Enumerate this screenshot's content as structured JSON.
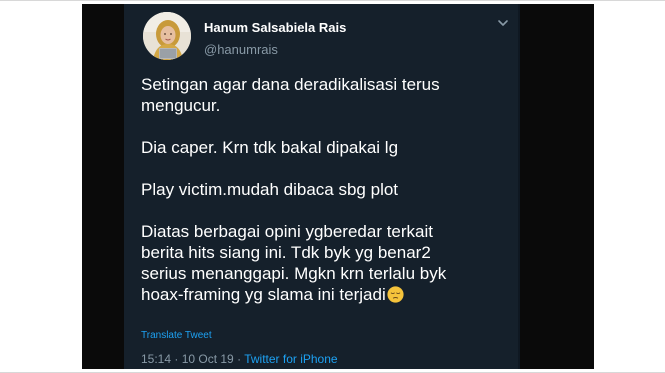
{
  "tweet": {
    "display_name": "Hanum Salsabiela Rais",
    "handle": "@hanumrais",
    "paragraphs": [
      {
        "lines": [
          "Setingan agar dana deradikalisasi terus",
          "mengucur."
        ]
      },
      {
        "lines": [
          "Dia caper. Krn tdk bakal dipakai lg"
        ]
      },
      {
        "lines": [
          "Play victim.mudah dibaca sbg plot"
        ]
      },
      {
        "lines": [
          "Diatas berbagai opini ygberedar terkait",
          "berita hits siang ini. Tdk byk yg benar2",
          "serius menanggapi. Mgkn krn terlalu byk",
          "hoax-framing yg slama ini terjadi"
        ]
      }
    ],
    "emoji": "pensive-face",
    "translate_label": "Translate Tweet",
    "time": "15:14",
    "date": "10 Oct 19",
    "separator": " · ",
    "source": "Twitter for iPhone"
  },
  "colors": {
    "card_background": "#15202b",
    "frame_band": "#0a0a0a",
    "text_primary": "#ffffff",
    "text_secondary": "#8899a6",
    "link": "#1da1f2"
  },
  "icons": {
    "caret": "chevron-down-icon",
    "avatar": "profile-avatar"
  }
}
